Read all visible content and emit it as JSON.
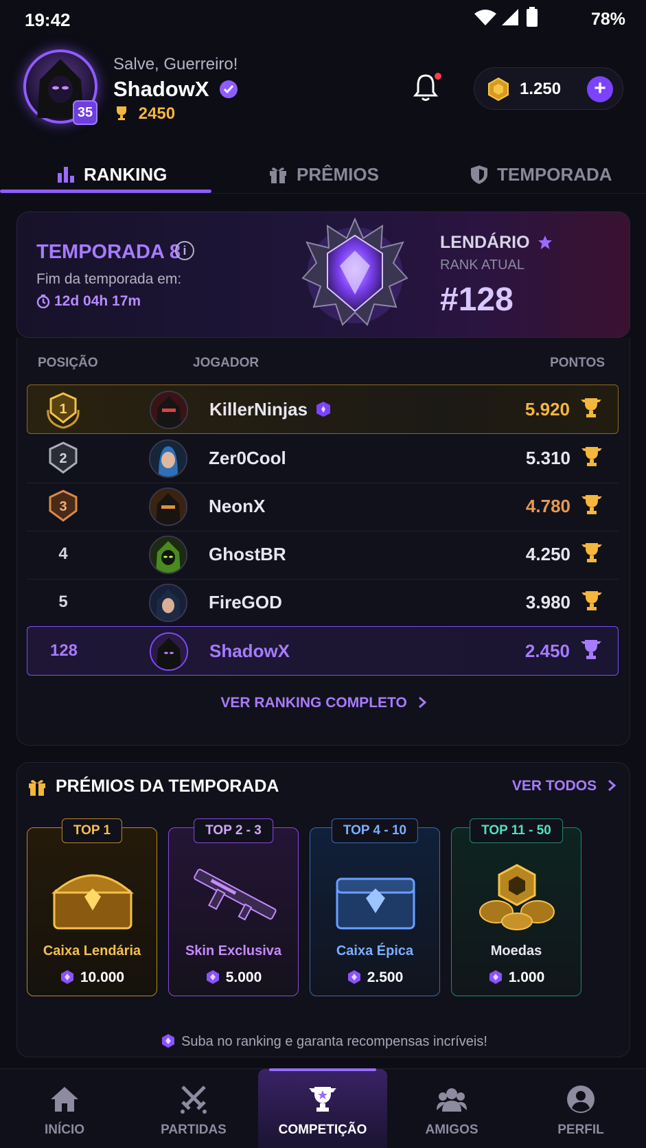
{
  "status_bar": {
    "time": "19:42",
    "battery": "78%"
  },
  "header": {
    "greeting": "Salve, Guerreiro!",
    "username": "ShadowX",
    "level": "35",
    "trophies": "2450",
    "coins": "1.250",
    "add_label": "+"
  },
  "tabs": [
    {
      "label": "RANKING",
      "icon": "bar-chart-icon",
      "active": true
    },
    {
      "label": "PRÊMIOS",
      "icon": "gift-icon",
      "active": false
    },
    {
      "label": "TEMPORADA",
      "icon": "shield-icon",
      "active": false
    }
  ],
  "season": {
    "title": "TEMPORADA 8",
    "info": "i",
    "end_label": "Fim da temporada em:",
    "countdown": "12d 04h 17m",
    "tier": "LENDÁRIO",
    "rank_label": "RANK ATUAL",
    "rank": "#128"
  },
  "ranking": {
    "col_position": "POSIÇÃO",
    "col_player": "JOGADOR",
    "col_points": "PONTOS",
    "rows": [
      {
        "pos": "1",
        "name": "KillerNinjas",
        "points": "5.920"
      },
      {
        "pos": "2",
        "name": "Zer0Cool",
        "points": "5.310"
      },
      {
        "pos": "3",
        "name": "NeonX",
        "points": "4.780"
      },
      {
        "pos": "4",
        "name": "GhostBR",
        "points": "4.250"
      },
      {
        "pos": "5",
        "name": "FireGOD",
        "points": "3.980"
      },
      {
        "pos": "128",
        "name": "ShadowX",
        "points": "2.450"
      }
    ],
    "view_full": "VER RANKING COMPLETO"
  },
  "prizes": {
    "title": "PRÉMIOS DA TEMPORADA",
    "view_all": "VER TODOS",
    "items": [
      {
        "badge": "TOP 1",
        "name": "Caixa Lendária",
        "value": "10.000",
        "color": "#e0a92e"
      },
      {
        "badge": "TOP 2 - 3",
        "name": "Skin Exclusiva",
        "value": "5.000",
        "color": "#b36cff"
      },
      {
        "badge": "TOP 4 - 10",
        "name": "Caixa Épica",
        "value": "2.500",
        "color": "#4f8fe0"
      },
      {
        "badge": "TOP 11 - 50",
        "name": "Moedas",
        "value": "1.000",
        "color": "#2fbfa0"
      }
    ],
    "footnote": "Suba no ranking e garanta recompensas incríveis!"
  },
  "nav": [
    {
      "label": "INÍCIO",
      "icon": "home-icon"
    },
    {
      "label": "PARTIDAS",
      "icon": "crossed-swords-icon"
    },
    {
      "label": "COMPETIÇÃO",
      "icon": "trophy-icon",
      "active": true
    },
    {
      "label": "AMIGOS",
      "icon": "friends-icon"
    },
    {
      "label": "PERFIL",
      "icon": "profile-icon"
    }
  ]
}
